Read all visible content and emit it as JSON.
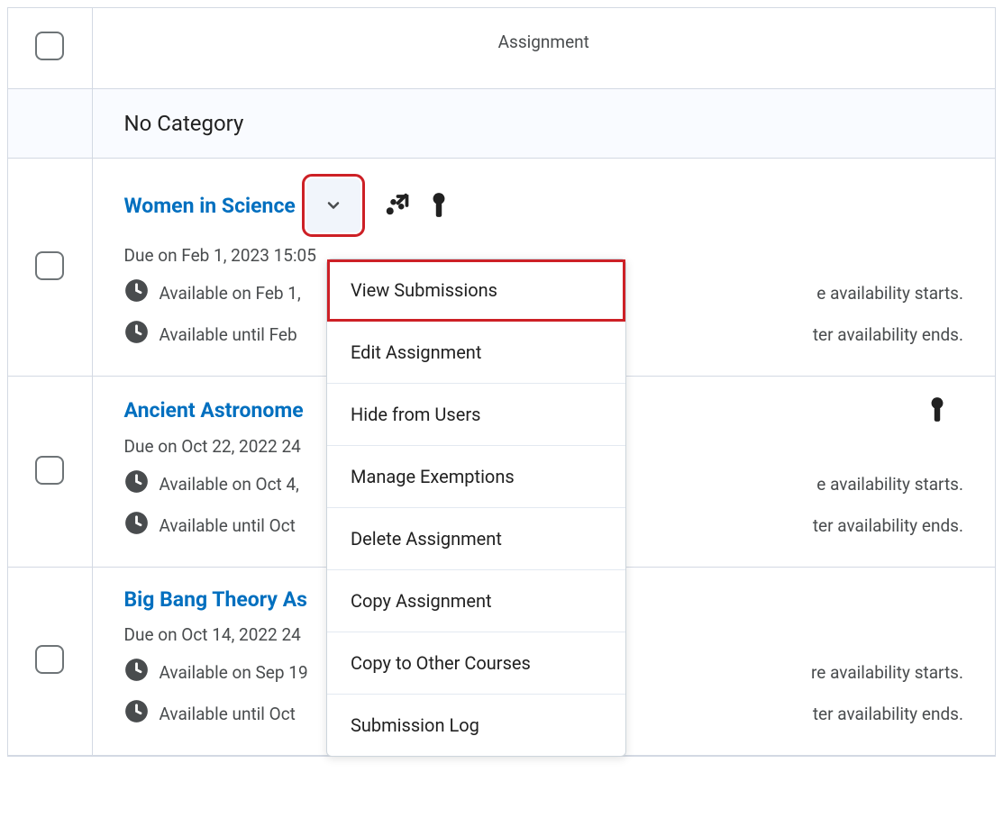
{
  "columns": {
    "assignment": "Assignment"
  },
  "category": "No Category",
  "assignments": [
    {
      "title": "Women in Science",
      "due": "Due on Feb 1, 2023 15:05",
      "avail_start_pre": "Available on Feb 1,",
      "avail_start_post": "e availability starts.",
      "avail_end_pre": "Available until Feb",
      "avail_end_post": "ter availability ends.",
      "chev_highlight": true
    },
    {
      "title": "Ancient Astronome",
      "due": "Due on Oct 22, 2022 24",
      "avail_start_pre": "Available on Oct 4,",
      "avail_start_post": "e availability starts.",
      "avail_end_pre": "Available until Oct",
      "avail_end_post": "ter availability ends."
    },
    {
      "title": "Big Bang Theory As",
      "due": "Due on Oct 14, 2022 24",
      "avail_start_pre": "Available on Sep 19",
      "avail_start_post": "re availability starts.",
      "avail_end_pre": "Available until Oct",
      "avail_end_post": "ter availability ends."
    }
  ],
  "menu": {
    "items": [
      "View Submissions",
      "Edit Assignment",
      "Hide from Users",
      "Manage Exemptions",
      "Delete Assignment",
      "Copy Assignment",
      "Copy to Other Courses",
      "Submission Log"
    ],
    "highlight_index": 0
  }
}
